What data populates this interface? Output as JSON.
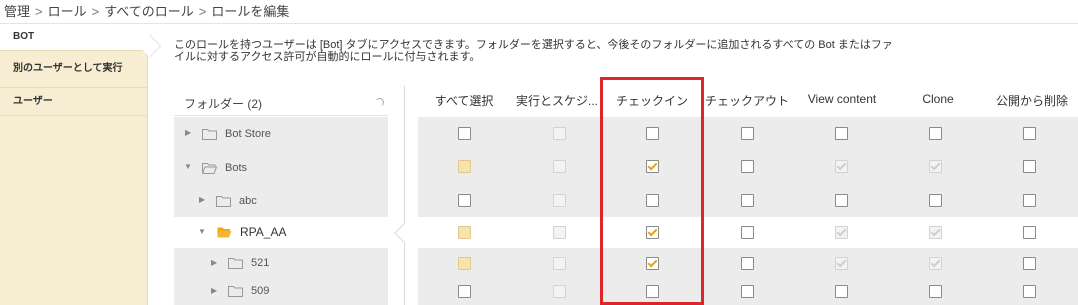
{
  "breadcrumb": [
    "管理",
    "ロール",
    "すべてのロール",
    "ロールを編集"
  ],
  "sidebar": {
    "items": [
      "BOT",
      "別のユーザーとして実行",
      "ユーザー"
    ]
  },
  "description": {
    "line1": "このロールを持つユーザーは [Bot] タブにアクセスできます。フォルダーを選択すると、今後そのフォルダーに追加されるすべての Bot またはファ",
    "line2": "イルに対するアクセス許可が自動的にロールに付与されます。"
  },
  "folder_panel": {
    "title": "フォルダー (2)"
  },
  "folders": [
    {
      "name": "Bot Store",
      "expanded": false,
      "level": 0
    },
    {
      "name": "Bots",
      "expanded": true,
      "level": 0
    },
    {
      "name": "abc",
      "expanded": false,
      "level": 1
    },
    {
      "name": "RPA_AA",
      "expanded": true,
      "level": 1,
      "selected": true
    },
    {
      "name": "521",
      "expanded": false,
      "level": 2
    },
    {
      "name": "509",
      "expanded": false,
      "level": 2
    }
  ],
  "columns": [
    "すべて選択",
    "実行とスケジ...",
    "チェックイン",
    "チェックアウト",
    "View content",
    "Clone",
    "公開から削除"
  ],
  "checkbox_states": [
    [
      "empty",
      "disabled",
      "empty",
      "empty",
      "empty",
      "empty",
      "empty"
    ],
    [
      "partial",
      "disabled",
      "checked",
      "empty",
      "disabled-checked",
      "disabled-checked",
      "empty"
    ],
    [
      "empty",
      "disabled",
      "empty",
      "empty",
      "empty",
      "empty",
      "empty"
    ],
    [
      "partial",
      "disabled",
      "checked",
      "empty",
      "disabled-checked",
      "disabled-checked",
      "empty"
    ],
    [
      "partial",
      "disabled",
      "checked",
      "empty",
      "disabled-checked",
      "disabled-checked",
      "empty"
    ],
    [
      "empty",
      "disabled",
      "empty",
      "empty",
      "empty",
      "empty",
      "empty"
    ]
  ],
  "colors": {
    "sidebar_bg": "#f6edd2",
    "check": "#e6a21a",
    "highlight": "#e0242b",
    "row_shade": "#ececec"
  }
}
